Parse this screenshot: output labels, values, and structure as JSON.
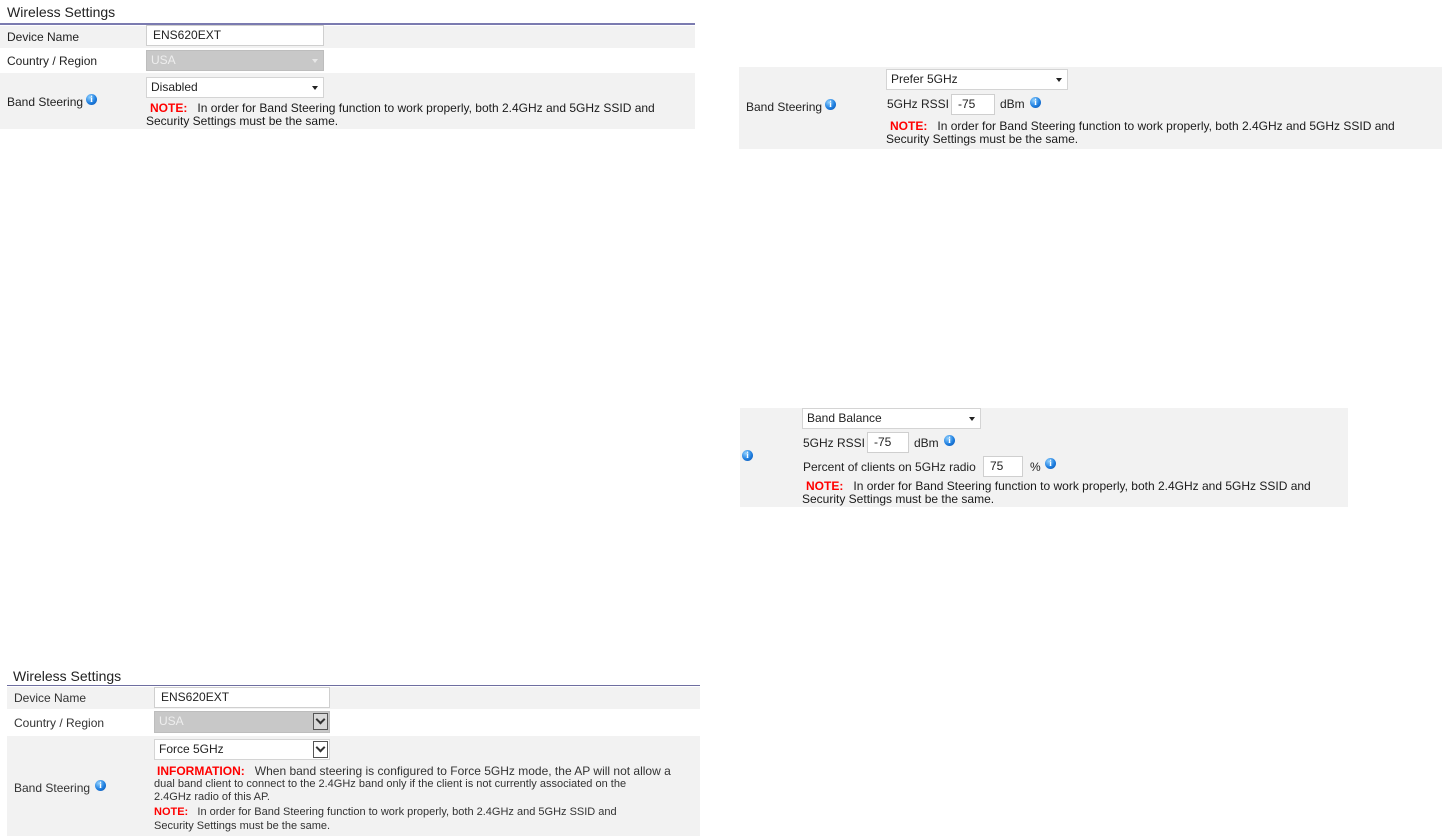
{
  "panel1": {
    "title": "Wireless Settings",
    "device_name_label": "Device Name",
    "device_name_value": "ENS620EXT",
    "country_label": "Country / Region",
    "country_value": "USA",
    "band_label": "Band Steering",
    "band_value": "Disabled",
    "note_key": "NOTE:",
    "note_text": "In order for Band Steering function to work properly, both 2.4GHz and 5GHz SSID and",
    "note_text2": "Security Settings must be the same."
  },
  "panel2": {
    "band_label": "Band Steering",
    "band_value": "Prefer 5GHz",
    "rssi_label": "5GHz RSSI",
    "rssi_value": "-75",
    "rssi_unit": "dBm",
    "note_key": "NOTE:",
    "note_text": "In order for Band Steering function to work properly, both 2.4GHz and 5GHz SSID and",
    "note_text2": "Security Settings must be the same."
  },
  "panel3": {
    "band_value": "Band Balance",
    "rssi_label": "5GHz RSSI",
    "rssi_value": "-75",
    "rssi_unit": "dBm",
    "percent_label": "Percent of clients on 5GHz radio",
    "percent_value": "75",
    "percent_unit": "%",
    "note_key": "NOTE:",
    "note_text": "In order for Band Steering function to work properly, both 2.4GHz and 5GHz SSID and",
    "note_text2": "Security Settings must be the same."
  },
  "panel4": {
    "title": "Wireless Settings",
    "device_name_label": "Device Name",
    "device_name_value": "ENS620EXT",
    "country_label": "Country / Region",
    "country_value": "USA",
    "band_label": "Band Steering",
    "band_value": "Force 5GHz",
    "info_key": "INFORMATION:",
    "info_text1": "When band steering is configured to Force 5GHz mode, the AP will not allow a",
    "info_text2": "dual band client to connect to the 2.4GHz band only if the client is not currently associated on the",
    "info_text3": "2.4GHz radio of this AP.",
    "note_key": "NOTE:",
    "note_text": "In order for Band Steering function to work properly, both 2.4GHz and 5GHz SSID and",
    "note_text2": "Security Settings must be the same."
  }
}
